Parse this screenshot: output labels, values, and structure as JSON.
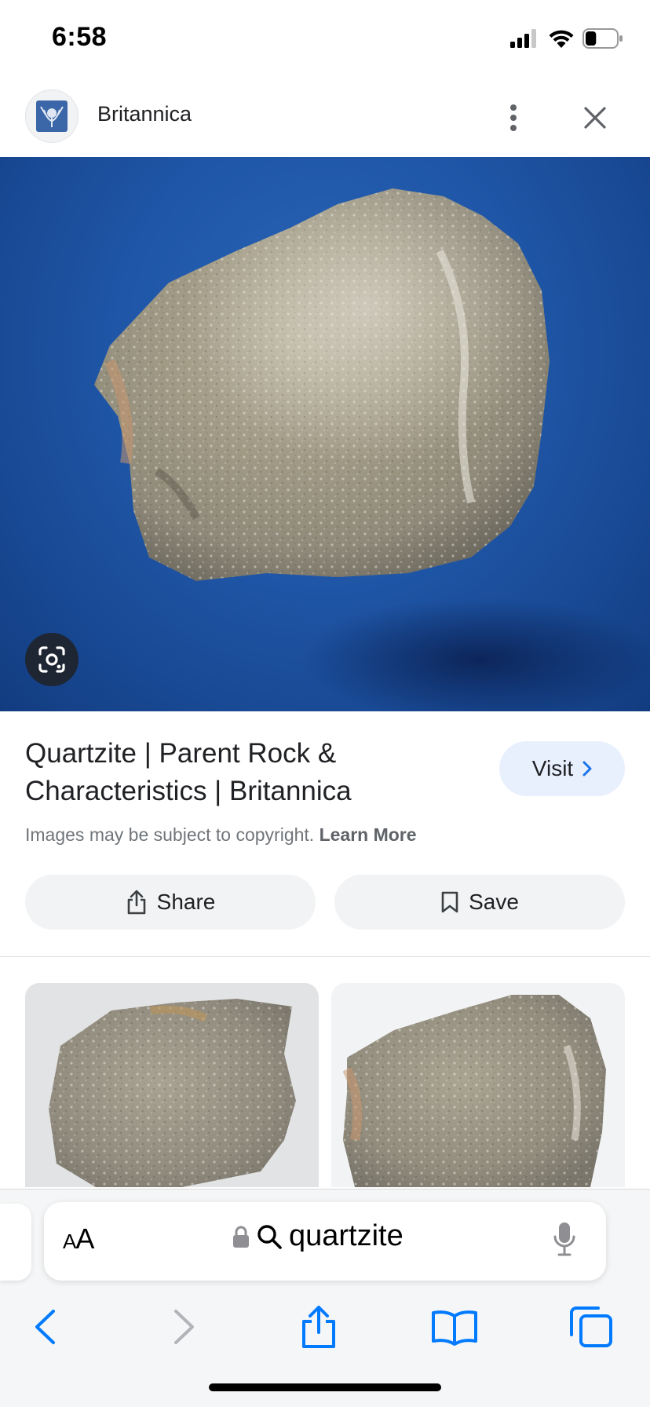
{
  "status_bar": {
    "time": "6:58",
    "battery_percent": 35
  },
  "header": {
    "site_name": "Britannica"
  },
  "result": {
    "title": "Quartzite | Parent Rock & Characteristics | Britannica",
    "visit_label": "Visit",
    "copyright_text": "Images may be subject to copyright.",
    "learn_more_label": "Learn More",
    "share_label": "Share",
    "save_label": "Save"
  },
  "related_images": [
    {
      "name": "related-image-1"
    },
    {
      "name": "related-image-2"
    }
  ],
  "browser": {
    "aa_label_small": "A",
    "aa_label_large": "A",
    "url_text": "quartzite"
  },
  "colors": {
    "accent": "#1a73e8",
    "safari_blue": "#007aff",
    "hero_background": "#1f56a7",
    "visit_bg": "#e8f0fe"
  },
  "icons": [
    "signal-icon",
    "wifi-icon",
    "battery-icon",
    "more-vert-icon",
    "close-icon",
    "lens-icon",
    "chevron-right-icon",
    "share-icon",
    "bookmark-icon",
    "lock-icon",
    "search-icon",
    "mic-icon",
    "back-icon",
    "forward-icon",
    "bookmarks-icon",
    "tabs-icon"
  ]
}
